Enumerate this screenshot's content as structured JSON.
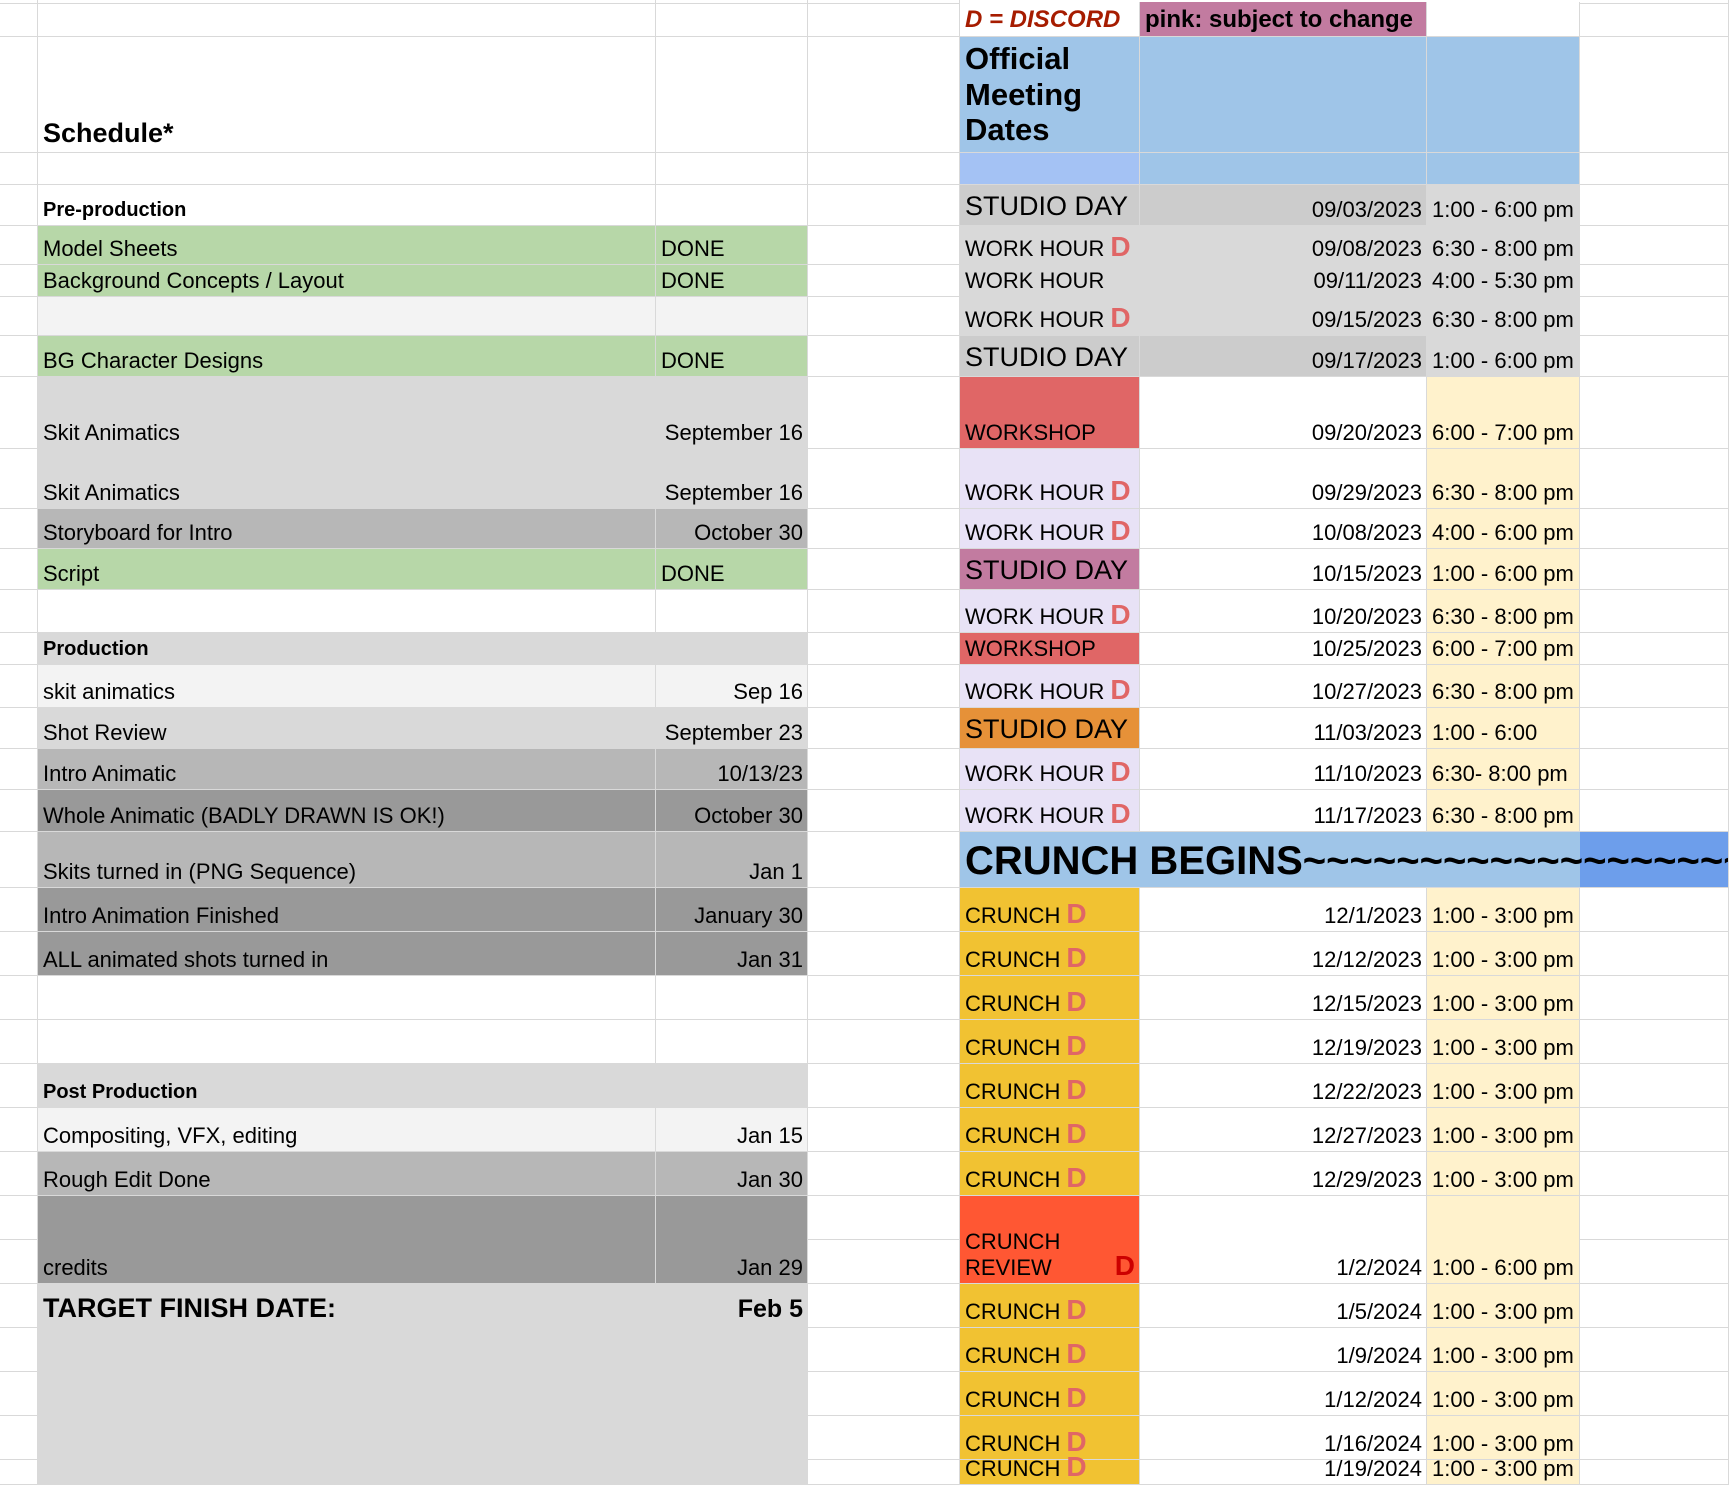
{
  "colors": {
    "green": "#b7d7a8",
    "light_gray": "#f3f3f3",
    "gray": "#d9d9d9",
    "mid_gray": "#b7b7b7",
    "dark_gray": "#999999",
    "studio_gray": "#cccccc",
    "light_blue": "#9fc5e8",
    "periwinkle": "#a4c2f4",
    "crunch_blue": "#6d9eeb",
    "workshop_red": "#e06666",
    "lavender": "#e8e2f6",
    "pink": "#c27ba0",
    "orange": "#e69138",
    "yellow": "#f1c232",
    "red_orange": "#ff5733",
    "cream": "#fff2cc",
    "discord_d": "#e06666",
    "discord_d_dark": "#cc0000"
  },
  "legend": {
    "discord": "D = DISCORD",
    "pink": "pink: subject to change"
  },
  "schedule": {
    "title": "Schedule*",
    "target_label": "TARGET FINISH DATE:",
    "target_value": "Feb 5",
    "pre_production": {
      "heading": "Pre-production",
      "items": [
        {
          "task": "Model Sheets",
          "status": "DONE"
        },
        {
          "task": "Background Concepts / Layout",
          "status": "DONE"
        },
        {
          "task": "BG Character Designs",
          "status": "DONE"
        },
        {
          "task": "Skit Animatics",
          "status": "September 16"
        },
        {
          "task": "Skit Animatics",
          "status": "September 16"
        },
        {
          "task": "Storyboard for Intro",
          "status": "October 30"
        },
        {
          "task": "Script",
          "status": "DONE"
        }
      ]
    },
    "production": {
      "heading": "Production",
      "items": [
        {
          "task": "skit animatics",
          "status": "Sep 16"
        },
        {
          "task": "Shot Review",
          "status": "September 23"
        },
        {
          "task": "Intro Animatic",
          "status": "10/13/23"
        },
        {
          "task": "Whole Animatic (BADLY DRAWN IS OK!)",
          "status": "October 30"
        },
        {
          "task": "Skits turned in (PNG Sequence)",
          "status": "Jan 1"
        },
        {
          "task": "Intro Animation Finished",
          "status": "January 30"
        },
        {
          "task": "ALL animated shots turned in",
          "status": "Jan 31"
        }
      ]
    },
    "post_production": {
      "heading": "Post Production",
      "items": [
        {
          "task": "Compositing, VFX, editing",
          "status": "Jan 15"
        },
        {
          "task": "Rough Edit Done",
          "status": "Jan 30"
        },
        {
          "task": "credits",
          "status": "Jan 29"
        }
      ]
    }
  },
  "meetings": {
    "title": "Official Meeting Dates",
    "crunch_banner": "CRUNCH BEGINS~~~~~~~~~~~~~~~~~~~",
    "discord_mark": "D",
    "rows": [
      {
        "label": "STUDIO DAY",
        "date": "09/03/2023",
        "time": "1:00 - 6:00 pm"
      },
      {
        "label": "WORK HOUR",
        "discord": true,
        "date": "09/08/2023",
        "time": "6:30 - 8:00 pm"
      },
      {
        "label": "WORK HOUR",
        "date": "09/11/2023",
        "time": "4:00 - 5:30 pm"
      },
      {
        "label": "WORK HOUR",
        "discord": true,
        "date": "09/15/2023",
        "time": "6:30 - 8:00 pm"
      },
      {
        "label": "STUDIO DAY",
        "date": "09/17/2023",
        "time": "1:00 - 6:00 pm"
      },
      {
        "label": "WORKSHOP",
        "date": "09/20/2023",
        "time": "6:00 - 7:00 pm"
      },
      {
        "label": "WORK HOUR",
        "discord": true,
        "date": "09/29/2023",
        "time": "6:30 - 8:00 pm"
      },
      {
        "label": "WORK HOUR",
        "discord": true,
        "date": "10/08/2023",
        "time": "4:00 - 6:00 pm"
      },
      {
        "label": "STUDIO DAY",
        "date": "10/15/2023",
        "time": "1:00 - 6:00 pm"
      },
      {
        "label": "WORK HOUR",
        "discord": true,
        "date": "10/20/2023",
        "time": "6:30 - 8:00 pm"
      },
      {
        "label": "WORKSHOP",
        "date": "10/25/2023",
        "time": "6:00 - 7:00 pm"
      },
      {
        "label": "WORK HOUR",
        "discord": true,
        "date": "10/27/2023",
        "time": "6:30 - 8:00 pm"
      },
      {
        "label": "STUDIO DAY",
        "date": "11/03/2023",
        "time": "1:00 - 6:00"
      },
      {
        "label": "WORK HOUR",
        "discord": true,
        "date": "11/10/2023",
        "time": "6:30- 8:00 pm"
      },
      {
        "label": "WORK HOUR",
        "discord": true,
        "date": "11/17/2023",
        "time": "6:30 - 8:00 pm"
      },
      {
        "label": "CRUNCH",
        "discord": true,
        "date": "12/1/2023",
        "time": "1:00 - 3:00 pm"
      },
      {
        "label": "CRUNCH",
        "discord": true,
        "date": "12/12/2023",
        "time": "1:00 - 3:00 pm"
      },
      {
        "label": "CRUNCH",
        "discord": true,
        "date": "12/15/2023",
        "time": "1:00 - 3:00 pm"
      },
      {
        "label": "CRUNCH",
        "discord": true,
        "date": "12/19/2023",
        "time": "1:00 - 3:00 pm"
      },
      {
        "label": "CRUNCH",
        "discord": true,
        "date": "12/22/2023",
        "time": "1:00 - 3:00 pm"
      },
      {
        "label": "CRUNCH",
        "discord": true,
        "date": "12/27/2023",
        "time": "1:00 - 3:00 pm"
      },
      {
        "label": "CRUNCH",
        "discord": true,
        "date": "12/29/2023",
        "time": "1:00 - 3:00 pm"
      },
      {
        "label": "CRUNCH REVIEW",
        "discord": true,
        "date": "1/2/2024",
        "time": "1:00 - 6:00 pm"
      },
      {
        "label": "CRUNCH",
        "discord": true,
        "date": "1/5/2024",
        "time": "1:00 - 3:00 pm"
      },
      {
        "label": "CRUNCH",
        "discord": true,
        "date": "1/9/2024",
        "time": "1:00 - 3:00 pm"
      },
      {
        "label": "CRUNCH",
        "discord": true,
        "date": "1/12/2024",
        "time": "1:00 - 3:00 pm"
      },
      {
        "label": "CRUNCH",
        "discord": true,
        "date": "1/16/2024",
        "time": "1:00 - 3:00 pm"
      },
      {
        "label": "CRUNCH",
        "discord": true,
        "date": "1/19/2024",
        "time": "1:00 - 3:00 pm"
      }
    ]
  }
}
